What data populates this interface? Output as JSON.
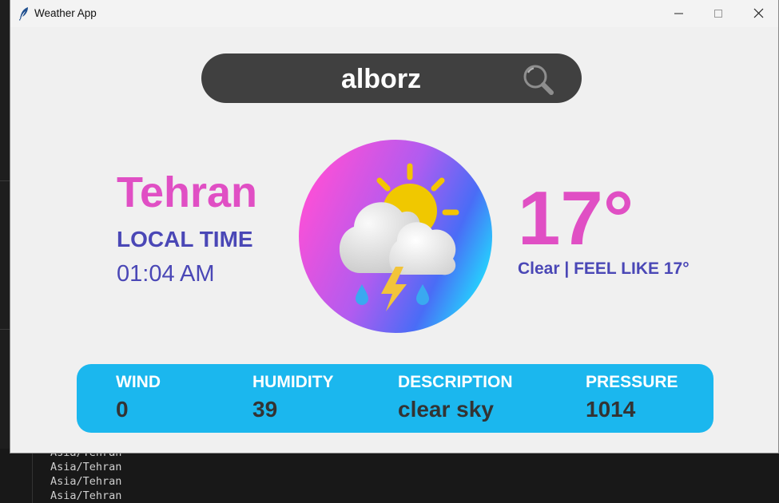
{
  "window": {
    "title": "Weather App"
  },
  "search": {
    "value": "alborz"
  },
  "location": {
    "city": "Tehran",
    "local_time_label": "LOCAL TIME",
    "local_time": "01:04 AM"
  },
  "current": {
    "temperature": "17°",
    "condition_line": "Clear | FEEL LIKE 17°",
    "icon": "thunderstorm-sun-cloud-icon"
  },
  "stats": {
    "wind_label": "WIND",
    "wind_value": "0",
    "humidity_label": "HUMIDITY",
    "humidity_value": "39",
    "description_label": "DESCRIPTION",
    "description_value": "clear sky",
    "pressure_label": "PRESSURE",
    "pressure_value": "1014"
  },
  "terminal": {
    "lines": [
      "Asia/Tehran",
      "Asia/Tehran",
      "Asia/Tehran",
      "Asia/Tehran"
    ]
  },
  "colors": {
    "city": "#e04fc4",
    "accent_text": "#4a47b6",
    "panel": "#1bb7ee",
    "search_bg": "#404040"
  }
}
